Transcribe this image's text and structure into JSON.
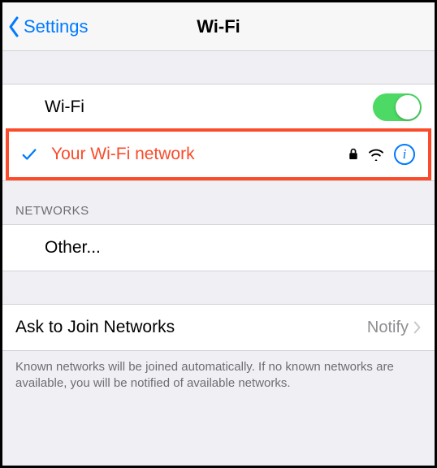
{
  "nav": {
    "back_label": "Settings",
    "title": "Wi-Fi"
  },
  "wifi": {
    "toggle_label": "Wi-Fi",
    "toggle_on": true,
    "connected": {
      "name": "Your Wi-Fi network",
      "secured": true,
      "signal": 3
    }
  },
  "sections": {
    "networks_header": "NETWORKS",
    "other_label": "Other..."
  },
  "ask": {
    "label": "Ask to Join Networks",
    "value": "Notify",
    "footer": "Known networks will be joined automatically. If no known networks are available, you will be notified of available networks."
  }
}
